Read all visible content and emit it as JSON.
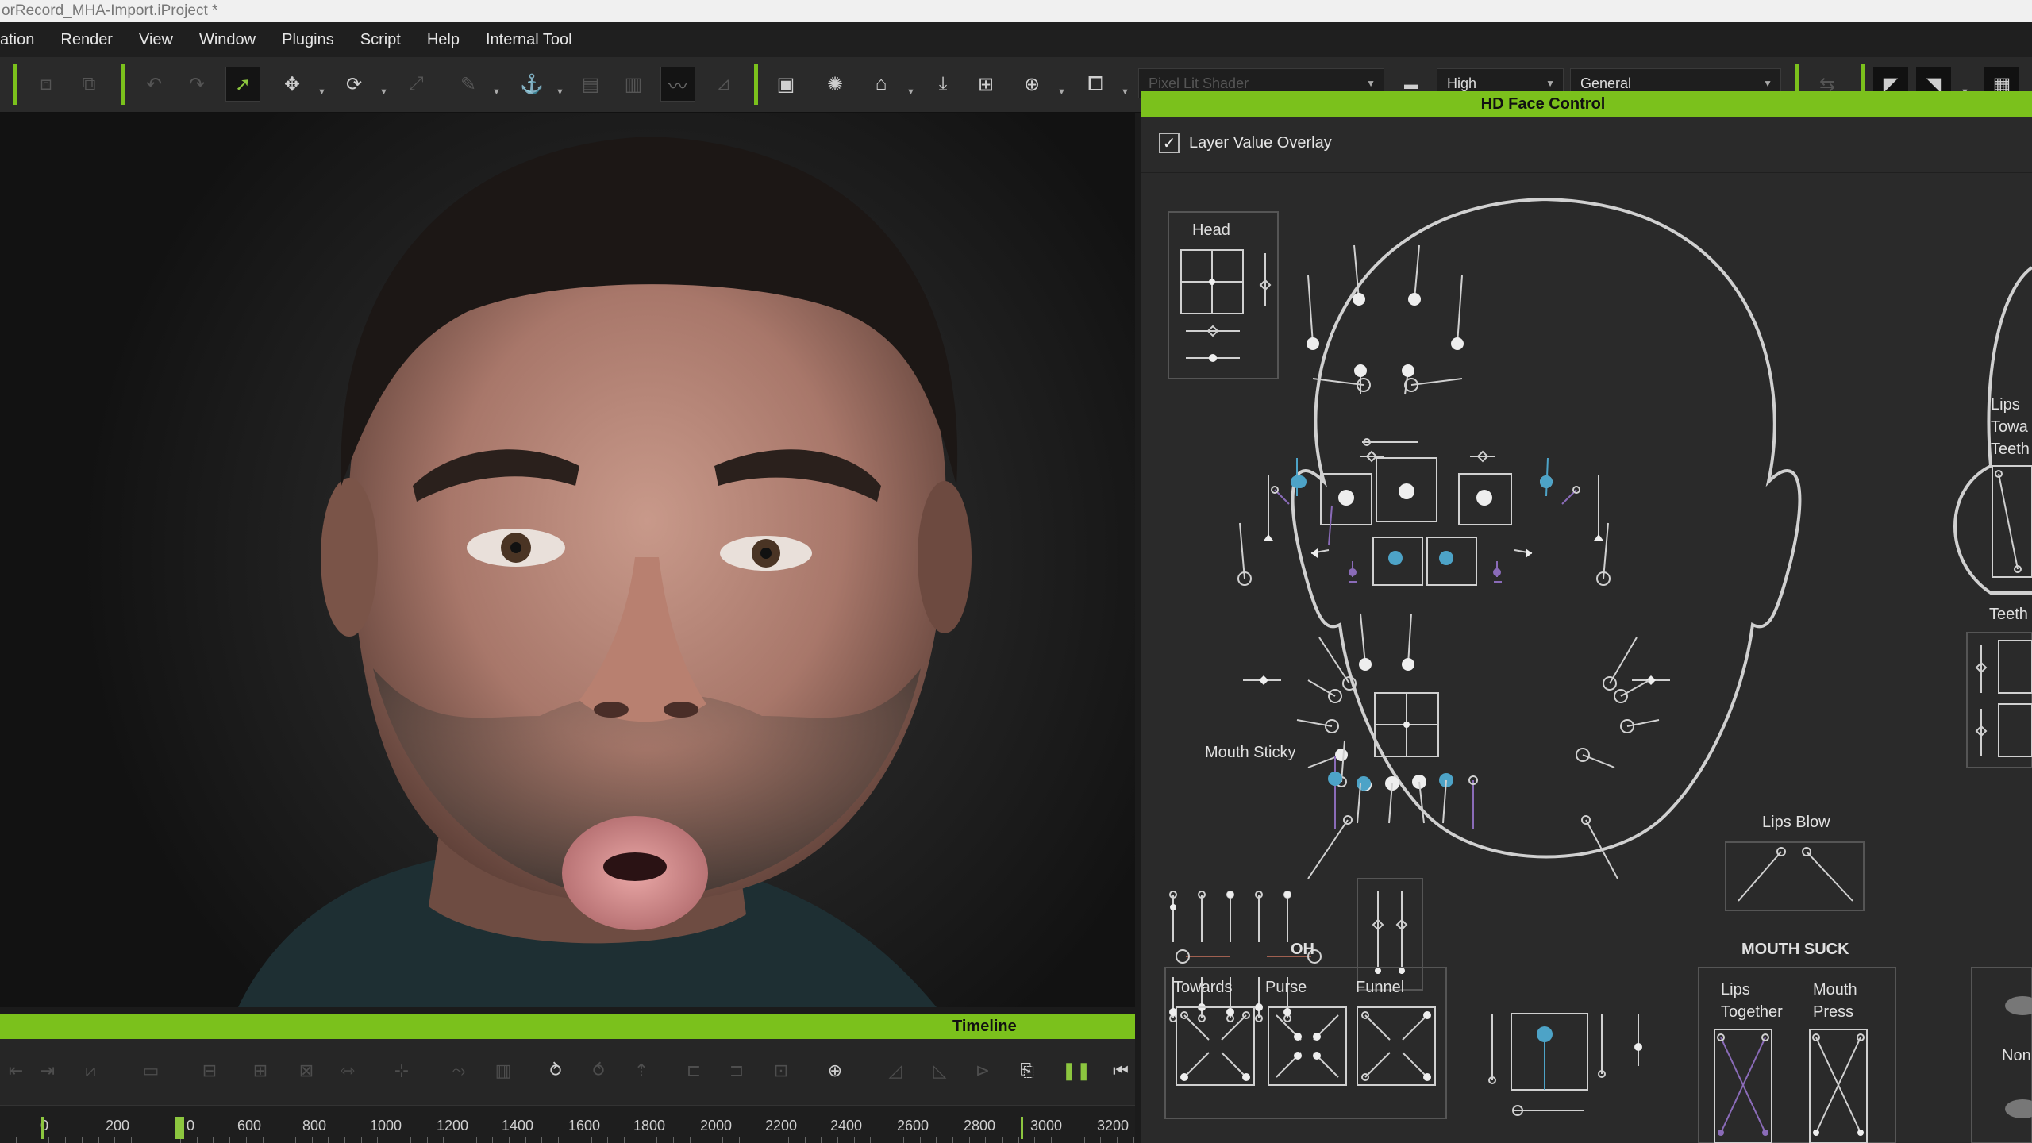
{
  "window": {
    "title": "orRecord_MHA-Import.iProject *"
  },
  "menu": {
    "items": [
      "ation",
      "Render",
      "View",
      "Window",
      "Plugins",
      "Script",
      "Help",
      "Internal Tool"
    ]
  },
  "toolbar": {
    "quality_select": "High",
    "mode_select": "General",
    "preset_select": "Pixel Lit Shader"
  },
  "viewport": {
    "subject": "3D character face close-up, lips pursed in OH shape"
  },
  "timeline": {
    "title": "Timeline",
    "ruler_labels": [
      "0",
      "200",
      "0",
      "600",
      "800",
      "1000",
      "1200",
      "1400",
      "1600",
      "1800",
      "2000",
      "2200",
      "2400",
      "2600",
      "2800",
      "3000",
      "3200"
    ]
  },
  "panel": {
    "title": "HD Face Control",
    "overlay_checkbox_label": "Layer Value Overlay",
    "overlay_checked": true,
    "head_label": "Head",
    "mouth_sticky_label": "Mouth Sticky",
    "oh_label": "OH",
    "oh_controls": [
      "Towards",
      "Purse",
      "Funnel"
    ],
    "lips_blow_label": "Lips Blow",
    "mouth_suck_label": "MOUTH SUCK",
    "mouth_suck_controls": [
      "Lips\nTogether",
      "Mouth\nPress"
    ],
    "side_labels": [
      "Lips",
      "Towa",
      "Teeth",
      "Teeth",
      "Non"
    ]
  },
  "colors": {
    "accent_green": "#7bc11c",
    "active_dot": "#4da3c7",
    "purple_slider": "#8a6bb8",
    "panel_bg": "#2a2a2a",
    "control_line": "#d0d0d0"
  }
}
